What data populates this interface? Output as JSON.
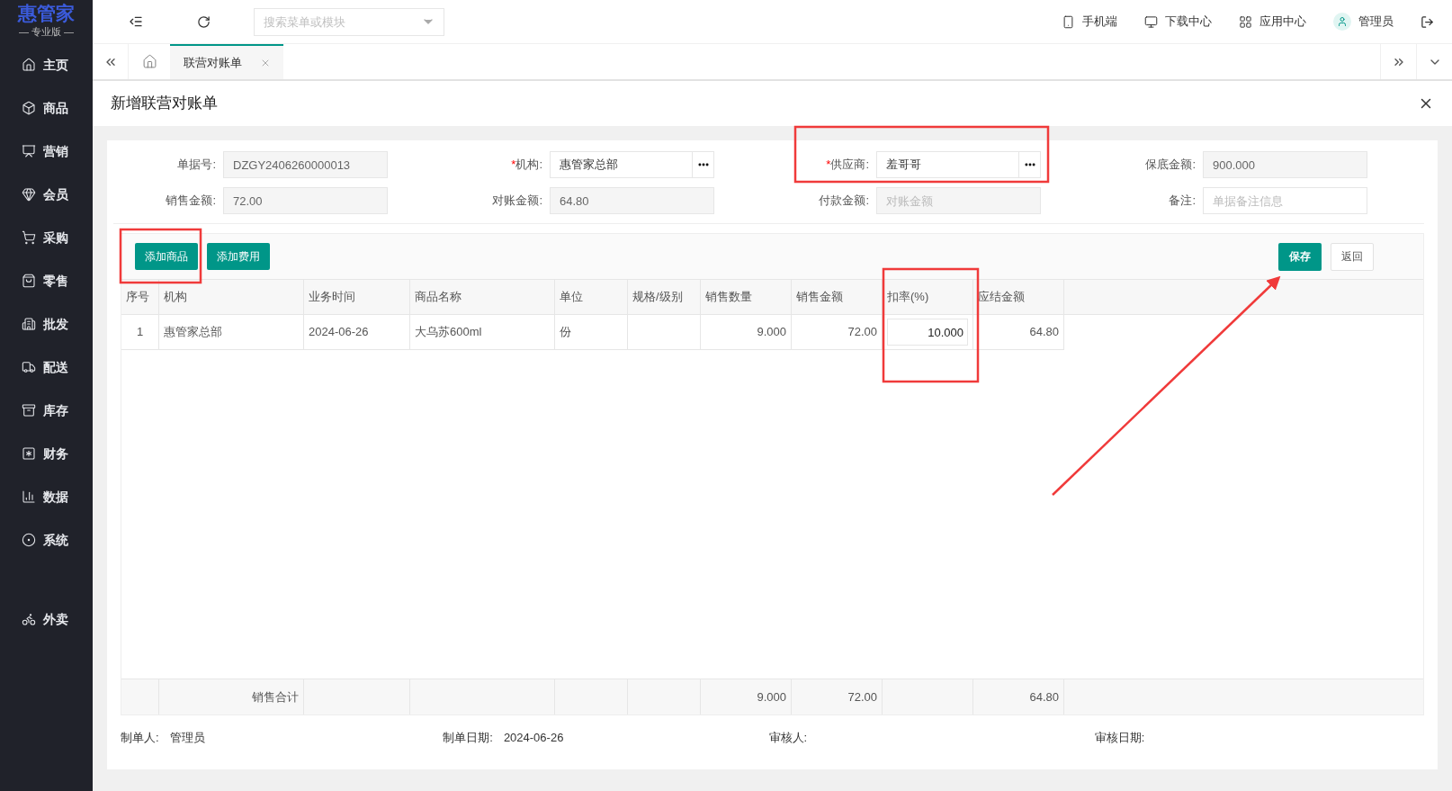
{
  "logo": {
    "name": "惠管家",
    "edition": "— 专业版 —"
  },
  "sidebar": {
    "items": [
      {
        "label": "主页",
        "selected": false
      },
      {
        "label": "商品",
        "selected": false
      },
      {
        "label": "营销",
        "selected": false
      },
      {
        "label": "会员",
        "selected": false
      },
      {
        "label": "采购",
        "selected": false
      },
      {
        "label": "零售",
        "selected": false
      },
      {
        "label": "批发",
        "selected": false
      },
      {
        "label": "配送",
        "selected": false
      },
      {
        "label": "库存",
        "selected": false
      },
      {
        "label": "财务",
        "selected": false
      },
      {
        "label": "数据",
        "selected": false
      },
      {
        "label": "系统",
        "selected": false
      }
    ],
    "extra_items": [
      {
        "label": "外卖",
        "selected": false
      }
    ]
  },
  "header": {
    "search": {
      "placeholder": "搜索菜单或模块"
    },
    "links": [
      "手机端",
      "下载中心",
      "应用中心",
      "管理员"
    ]
  },
  "tabs": [
    {
      "label": "联营对账单",
      "selected": true
    }
  ],
  "page_title": "新增联营对账单",
  "form": {
    "fields": [
      {
        "label": "单据号:",
        "kind": "readonly",
        "value": "DZGY2406260000013"
      },
      {
        "asterisk": "*",
        "label": "机构:",
        "kind": "picker",
        "value": "惠管家总部"
      },
      {
        "asterisk": "*",
        "label": "供应商:",
        "kind": "picker",
        "value": "羞哥哥"
      },
      {
        "label": "保底金额:",
        "kind": "readonly",
        "value": "900.000"
      },
      {
        "label": "销售金额:",
        "kind": "readonly",
        "value": "72.00"
      },
      {
        "label": "对账金额:",
        "kind": "readonly",
        "value": "64.80"
      },
      {
        "label": "付款金额:",
        "kind": "readonly",
        "placeholder": "对账金额"
      },
      {
        "label": "备注:",
        "kind": "input",
        "placeholder": "单据备注信息"
      }
    ]
  },
  "toolbar": {
    "left": [
      "添加商品",
      "添加费用"
    ],
    "save": "保存",
    "back": "返回"
  },
  "table": {
    "columns": [
      "序号",
      "机构",
      "业务时间",
      "商品名称",
      "单位",
      "规格/级别",
      "销售数量",
      "销售金额",
      "扣率(%)",
      "应结金额"
    ],
    "rows": [
      [
        {
          "kind": "center",
          "text": "1"
        },
        {
          "kind": "text",
          "text": "惠管家总部"
        },
        {
          "kind": "text",
          "text": "2024-06-26"
        },
        {
          "kind": "text",
          "text": "大乌苏600ml"
        },
        {
          "kind": "text",
          "text": "份"
        },
        {
          "kind": "empty"
        },
        {
          "kind": "number",
          "text": "9.000"
        },
        {
          "kind": "number",
          "text": "72.00"
        },
        {
          "kind": "input",
          "text": "10.000"
        },
        {
          "kind": "number",
          "text": "64.80"
        }
      ]
    ],
    "footer": [
      {
        "kind": "empty"
      },
      {
        "kind": "number",
        "text": "销售合计"
      },
      {
        "kind": "empty"
      },
      {
        "kind": "empty"
      },
      {
        "kind": "empty"
      },
      {
        "kind": "empty"
      },
      {
        "kind": "number",
        "text": "9.000"
      },
      {
        "kind": "number",
        "text": "72.00"
      },
      {
        "kind": "empty"
      },
      {
        "kind": "number",
        "text": "64.80"
      }
    ]
  },
  "signatures": [
    {
      "label": "制单人:",
      "value": "管理员"
    },
    {
      "label": "制单日期:",
      "value": "2024-06-26"
    },
    {
      "label": "审核人:"
    },
    {
      "label": "审核日期:"
    }
  ]
}
